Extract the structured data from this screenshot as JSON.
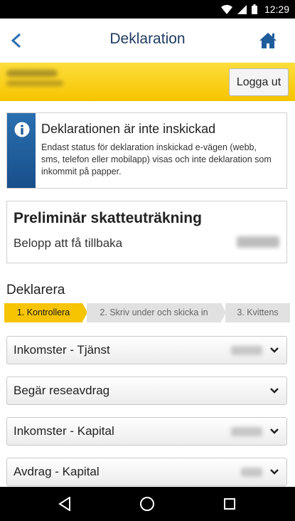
{
  "status_bar": {
    "time": "12:29",
    "icons": [
      "wifi-icon",
      "signal-icon",
      "battery-icon"
    ]
  },
  "app_bar": {
    "title": "Deklaration",
    "icons": [
      "back-arrow-icon",
      "home-icon"
    ]
  },
  "user_bar": {
    "logout_label": "Logga ut"
  },
  "notice": {
    "icon": "info-icon",
    "title": "Deklarationen är inte inskickad",
    "text": "Endast status för deklaration inskickad e-vägen (webb, sms, telefon eller mobilapp) visas och inte deklaration som inkommit på papper."
  },
  "estimate": {
    "title": "Preliminär skatteuträkning",
    "label": "Belopp att få tillbaka"
  },
  "section": {
    "title": "Deklarera"
  },
  "steps": [
    {
      "label": "1. Kontrollera",
      "active": true
    },
    {
      "label": "2. Skriv under och skicka in",
      "active": false
    },
    {
      "label": "3. Kvittens",
      "active": false
    }
  ],
  "accordions": [
    {
      "label": "Inkomster - Tjänst"
    },
    {
      "label": "Begär reseavdrag"
    },
    {
      "label": "Inkomster - Kapital"
    },
    {
      "label": "Avdrag - Kapital"
    }
  ],
  "colors": {
    "accent_yellow": "#f6c400",
    "info_blue": "#1f5c9c",
    "title_navy": "#1f3a5f"
  },
  "nav_bar": {
    "icons": [
      "nav-back-icon",
      "nav-home-icon",
      "nav-recents-icon"
    ]
  }
}
